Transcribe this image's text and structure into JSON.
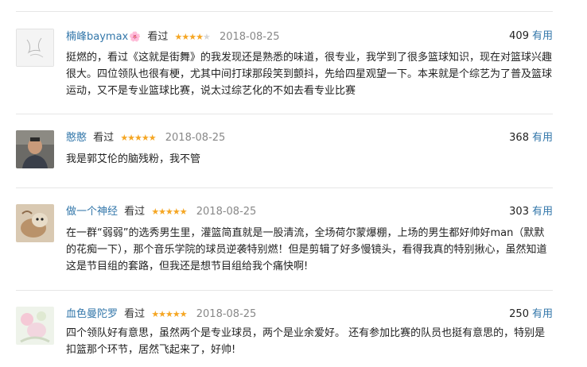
{
  "comments": [
    {
      "author": "楠峰baymax",
      "author_emoji": "🌸",
      "watched": "看过",
      "rating": 4,
      "date": "2018-08-25",
      "votes": "409",
      "useful_label": "有用",
      "text": "挺燃的，看过《这就是街舞》的我发现还是熟悉的味道，很专业，我学到了很多篮球知识，现在对篮球兴趣很大。四位领队也很有梗，尤其中间打球那段笑到颤抖，先给四星观望一下。本来就是个综艺为了普及篮球运动，又不是专业篮球比赛，说太过综艺化的不如去看专业比赛"
    },
    {
      "author": "憨憨",
      "watched": "看过",
      "rating": 5,
      "date": "2018-08-25",
      "votes": "368",
      "useful_label": "有用",
      "text": "我是郭艾伦的脑残粉，我不管"
    },
    {
      "author": "做一个神经",
      "watched": "看过",
      "rating": 5,
      "date": "2018-08-25",
      "votes": "303",
      "useful_label": "有用",
      "text": "在一群“弱弱”的选秀男生里，灌篮简直就是一股清流，全场荷尔蒙爆棚，上场的男生都好帅好man（默默的花痴一下），那个音乐学院的球员逆袭特别燃！但是剪辑了好多慢镜头，看得我真的特别揪心，虽然知道这是节目组的套路，但我还是想节目组给我个痛快啊!"
    },
    {
      "author": "血色曼陀罗",
      "watched": "看过",
      "rating": 5,
      "date": "2018-08-25",
      "votes": "250",
      "useful_label": "有用",
      "text": "四个领队好有意思，虽然两个是专业球员，两个是业余爱好。 还有参加比赛的队员也挺有意思的，特别是扣篮那个环节，居然飞起来了，好帅!"
    }
  ]
}
